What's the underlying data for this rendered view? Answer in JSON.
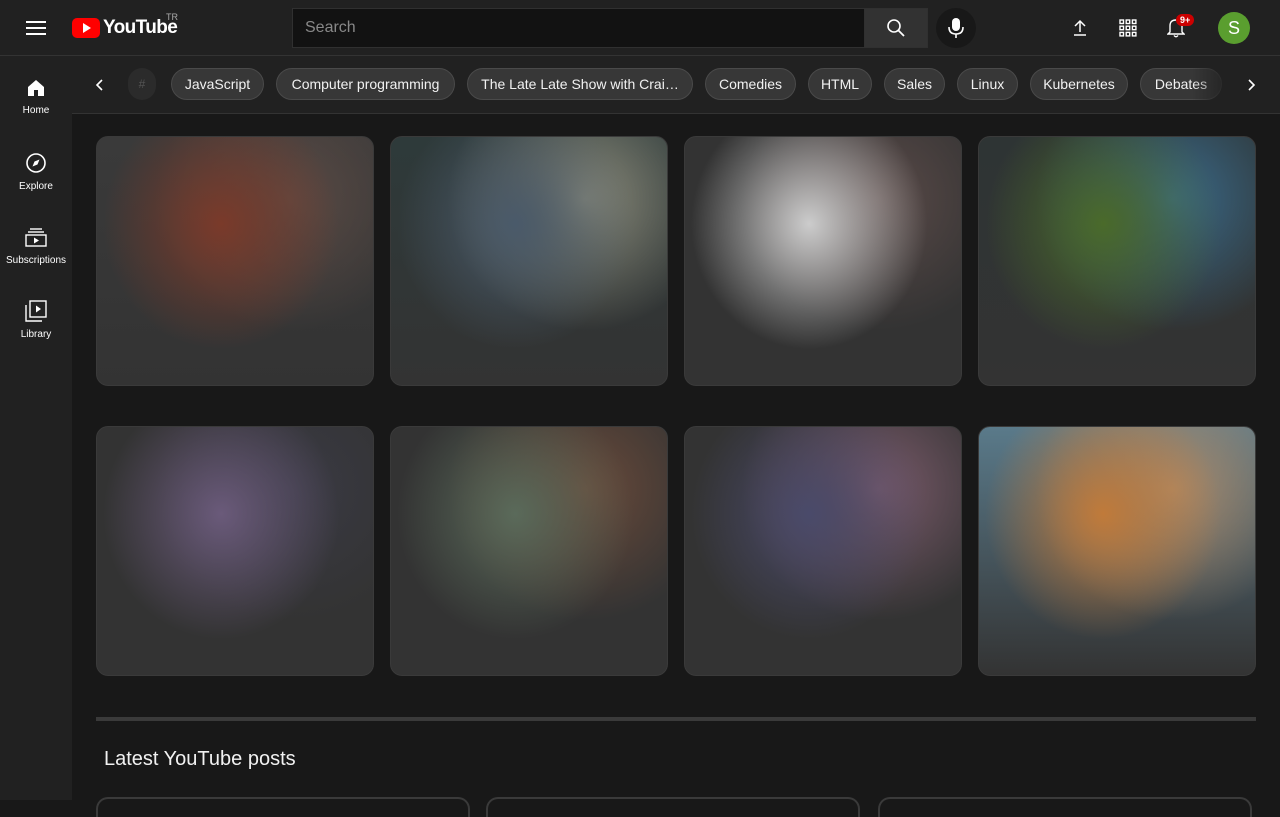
{
  "header": {
    "logo_text": "YouTube",
    "country_code": "TR",
    "search_placeholder": "Search",
    "notification_count": "9+",
    "avatar_letter": "S"
  },
  "sidebar": {
    "items": [
      {
        "label": "Home",
        "icon": "home-icon"
      },
      {
        "label": "Explore",
        "icon": "compass-icon"
      },
      {
        "label": "Subscriptions",
        "icon": "subscriptions-icon"
      },
      {
        "label": "Library",
        "icon": "library-icon"
      }
    ]
  },
  "chips": [
    "JavaScript",
    "Computer programming",
    "The Late Late Show with Crai…",
    "Comedies",
    "HTML",
    "Sales",
    "Linux",
    "Kubernetes",
    "Debates"
  ],
  "videos": [
    {
      "thumb_colors": [
        "#7a3a2a",
        "#5a4a44",
        "#3a3a3a"
      ]
    },
    {
      "thumb_colors": [
        "#4a5a6a",
        "#8a8a7a",
        "#2e3a3a"
      ]
    },
    {
      "thumb_colors": [
        "#cccccc",
        "#5a4a48",
        "#333333"
      ]
    },
    {
      "thumb_colors": [
        "#4a6a2a",
        "#3a6a8a",
        "#2e3434"
      ]
    },
    {
      "thumb_colors": [
        "#6a5a7a",
        "#3a3a44",
        "#333333"
      ]
    },
    {
      "thumb_colors": [
        "#5a6a5a",
        "#6a4a3a",
        "#333333"
      ]
    },
    {
      "thumb_colors": [
        "#4a4a6a",
        "#7a5a6a",
        "#333333"
      ]
    },
    {
      "thumb_colors": [
        "#c07a3a",
        "#aa8a6a",
        "#5a7a8a"
      ]
    }
  ],
  "sections": {
    "latest_posts_title": "Latest YouTube posts"
  }
}
